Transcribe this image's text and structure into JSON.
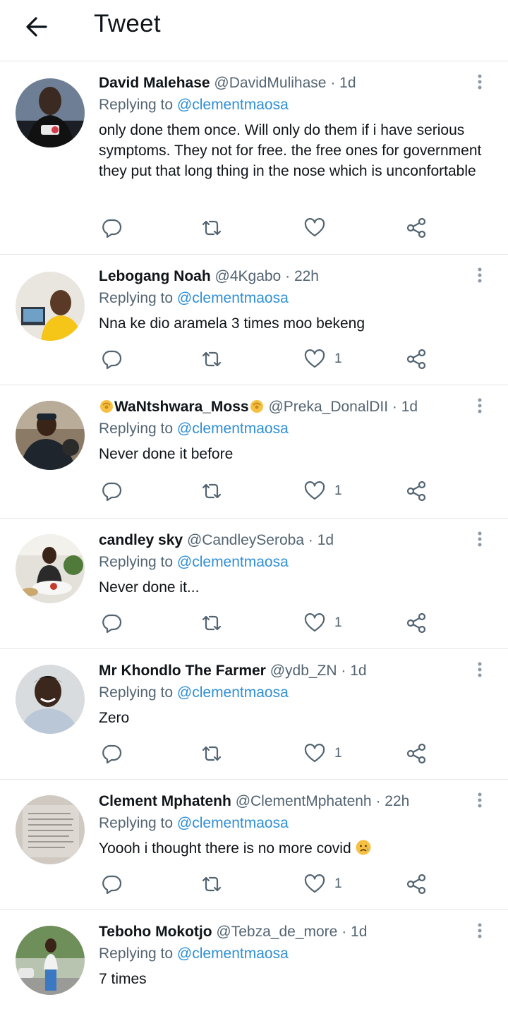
{
  "header": {
    "title": "Tweet",
    "back_icon": "arrow-left-icon"
  },
  "colors": {
    "mention": "#2f8fd6",
    "secondary": "#536471",
    "divider": "#e6e6e6"
  },
  "replies": [
    {
      "name": "David Malehase",
      "handle": "@DavidMulihase",
      "dot": "·",
      "time": "1d",
      "replying_prefix": "Replying to ",
      "replying_to": "@clementmaosa",
      "text": "only done them once. Will only do them if i have serious symptoms. They not for free. the free ones for government they put that long thing in the nose which is unconfortable",
      "like_count": ""
    },
    {
      "name": "Lebogang Noah",
      "handle": "@4Kgabo",
      "dot": "·",
      "time": "22h",
      "replying_prefix": "Replying to ",
      "replying_to": "@clementmaosa",
      "text": "Nna ke dio aramela 3 times moo bekeng",
      "like_count": "1"
    },
    {
      "name": "WaNtshwara_Moss",
      "name_emoji": "pinching-hand-emoji",
      "handle": "@Preka_DonalDII",
      "dot": "·",
      "time": "1d",
      "replying_prefix": "Replying to ",
      "replying_to": "@clementmaosa",
      "text": "Never done it before",
      "like_count": "1"
    },
    {
      "name": "candley sky",
      "handle": "@CandleySeroba",
      "dot": "·",
      "time": "1d",
      "replying_prefix": "Replying to ",
      "replying_to": "@clementmaosa",
      "text": "Never done it...",
      "like_count": "1"
    },
    {
      "name": "Mr Khondlo The Farmer",
      "handle": "@ydb_ZN",
      "dot": "·",
      "time": "1d",
      "replying_prefix": "Replying to ",
      "replying_to": "@clementmaosa",
      "text": "Zero",
      "like_count": "1"
    },
    {
      "name": "Clement Mphatenh",
      "handle": "@ClementMphatenh",
      "dot": "·",
      "time": "22h",
      "replying_prefix": "Replying to ",
      "replying_to": "@clementmaosa",
      "text": "Yoooh i thought there is no more covid",
      "text_emoji": "sad-relieved-face-emoji",
      "like_count": "1"
    },
    {
      "name": "Teboho Mokotjo",
      "handle": "@Tebza_de_more",
      "dot": "·",
      "time": "1d",
      "replying_prefix": "Replying to ",
      "replying_to": "@clementmaosa",
      "text": "7 times",
      "like_count": ""
    }
  ]
}
